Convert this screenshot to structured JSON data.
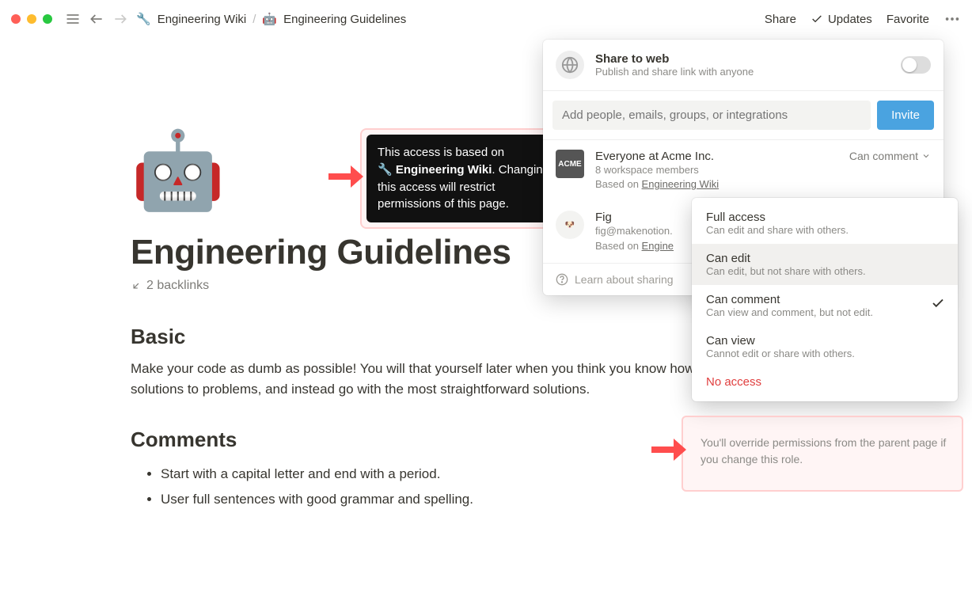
{
  "breadcrumb": {
    "wrench_icon": "🔧",
    "parent": "Engineering Wiki",
    "sep": "/",
    "robot_icon": "🤖",
    "current": "Engineering Guidelines"
  },
  "top_right": {
    "share": "Share",
    "updates": "Updates",
    "favorite": "Favorite"
  },
  "page": {
    "icon": "🤖",
    "title": "Engineering Guidelines",
    "backlinks": "2 backlinks",
    "section1_title": "Basic",
    "section1_body": "Make your code as dumb as possible! You will that yourself later when you think you know how it works. Avoid clever solutions to problems, and instead go with the most straightforward solutions.",
    "section2_title": "Comments",
    "bullets": [
      "Start with a capital letter and end with a period.",
      "User full sentences with good grammar and spelling."
    ]
  },
  "tooltip": {
    "line1": "This access is based on ",
    "bold": "Engineering Wiki",
    "line2": ". Changing this access will restrict permissions of this page."
  },
  "share_panel": {
    "web_title": "Share to web",
    "web_sub": "Publish and share link with anyone",
    "invite_placeholder": "Add people, emails, groups, or integrations",
    "invite_btn": "Invite",
    "members": [
      {
        "avatar": "ACME",
        "name": "Everyone at Acme Inc.",
        "line1": "8 workspace members",
        "based_prefix": "Based on ",
        "based_link": "Engineering Wiki",
        "perm": "Can comment"
      },
      {
        "avatar": "🐶",
        "name": "Fig",
        "line1": "fig@makenotion.",
        "based_prefix": "Based on ",
        "based_link": "Engine",
        "perm": ""
      }
    ],
    "learn": "Learn about sharing"
  },
  "perm_dropdown": [
    {
      "title": "Full access",
      "sub": "Can edit and share with others.",
      "checked": false
    },
    {
      "title": "Can edit",
      "sub": "Can edit, but not share with others.",
      "checked": false
    },
    {
      "title": "Can comment",
      "sub": "Can view and comment, but not edit.",
      "checked": true
    },
    {
      "title": "Can view",
      "sub": "Cannot edit or share with others.",
      "checked": false
    },
    {
      "title": "No access",
      "sub": "",
      "checked": false,
      "danger": true
    }
  ],
  "override_warning": "You'll override permissions from the parent page if you change this role."
}
